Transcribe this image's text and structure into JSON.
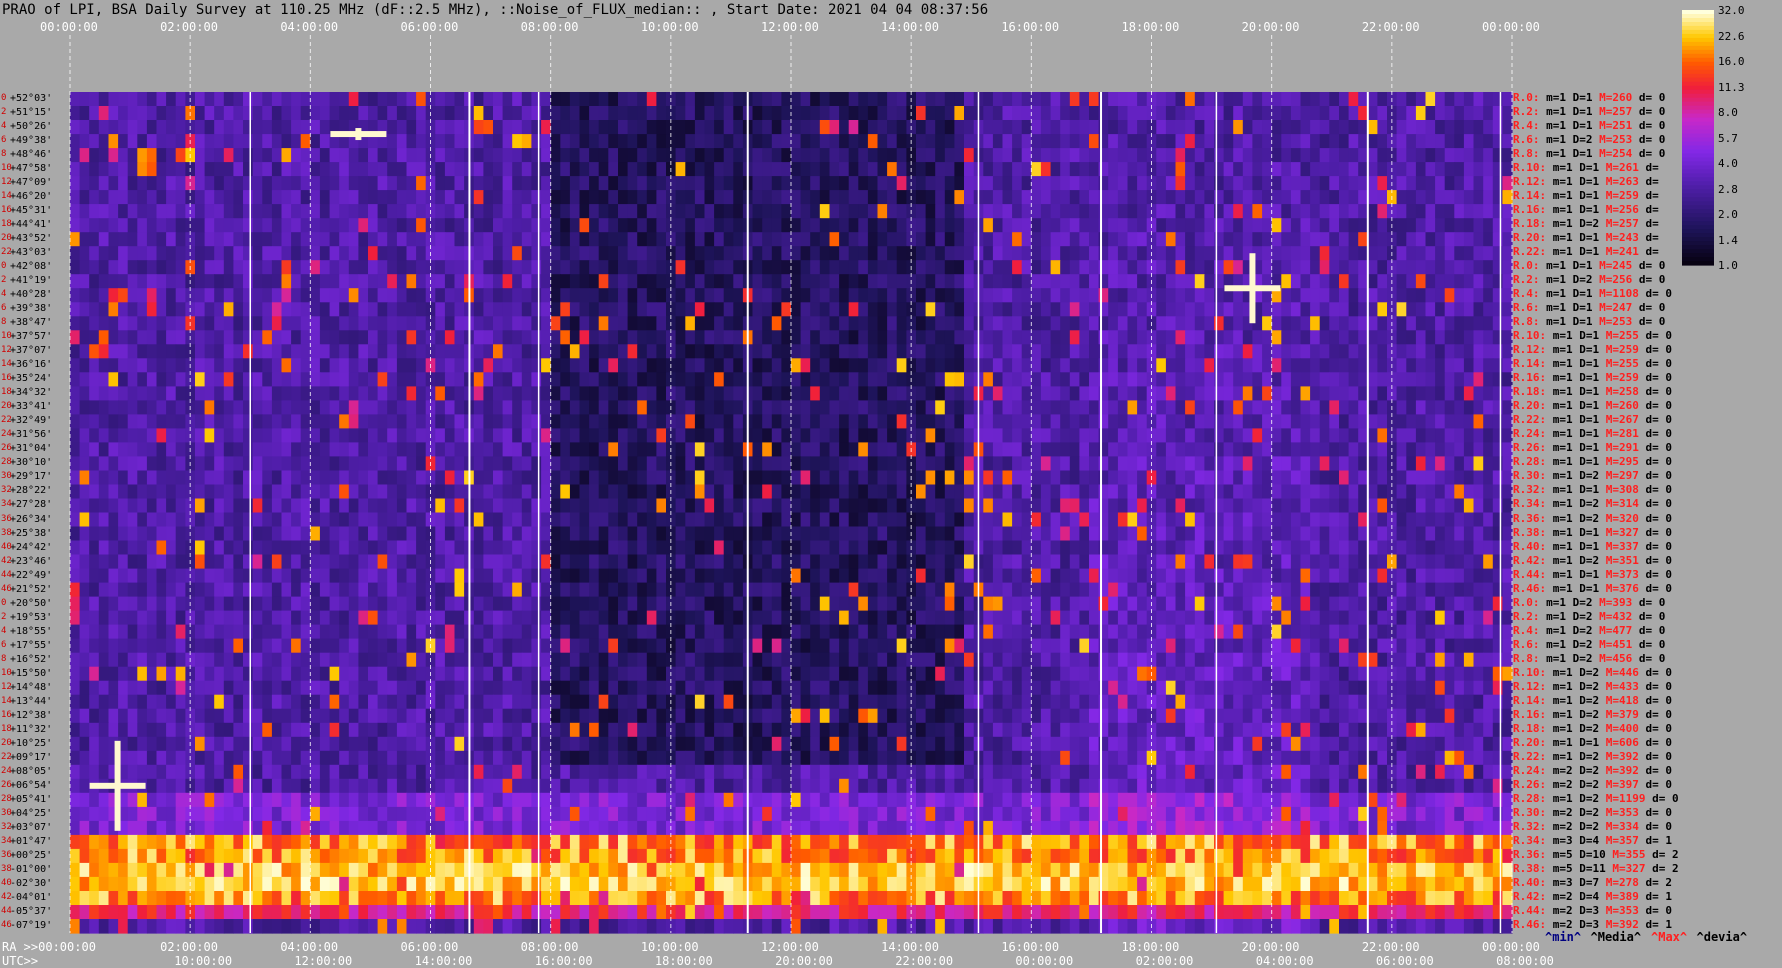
{
  "title": "PRAO of LPI, BSA Daily Survey at 110.25 MHz (dF::2.5 MHz), ::Noise_of_FLUX_median:: , Start Date: 2021 04 04 08:37:56",
  "chart_data": {
    "type": "heatmap",
    "x_axis_top": [
      "00:00:00",
      "02:00:00",
      "04:00:00",
      "06:00:00",
      "08:00:00",
      "10:00:00",
      "12:00:00",
      "14:00:00",
      "16:00:00",
      "18:00:00",
      "20:00:00",
      "22:00:00",
      "00:00:00"
    ],
    "x_axis_ra_bottom": [
      "RA >>00:00:00",
      "02:00:00",
      "04:00:00",
      "06:00:00",
      "08:00:00",
      "10:00:00",
      "12:00:00",
      "14:00:00",
      "16:00:00",
      "18:00:00",
      "20:00:00",
      "22:00:00",
      "00:00:00"
    ],
    "x_axis_utc": [
      "UTC>>",
      "10:00:00",
      "12:00:00",
      "14:00:00",
      "16:00:00",
      "18:00:00",
      "20:00:00",
      "22:00:00",
      "00:00:00",
      "02:00:00",
      "04:00:00",
      "06:00:00",
      "08:00:00"
    ],
    "y_labels": [
      "+52°03'",
      "+51°15'",
      "+50°26'",
      "+49°38'",
      "+48°46'",
      "+47°58'",
      "+47°09'",
      "+46°20'",
      "+45°31'",
      "+44°41'",
      "+43°52'",
      "+43°03'",
      "+42°08'",
      "+41°19'",
      "+40°28'",
      "+39°38'",
      "+38°47'",
      "+37°57'",
      "+37°07'",
      "+36°16'",
      "+35°24'",
      "+34°32'",
      "+33°41'",
      "+32°49'",
      "+31°56'",
      "+31°04'",
      "+30°10'",
      "+29°17'",
      "+28°22'",
      "+27°28'",
      "+26°34'",
      "+25°38'",
      "+24°42'",
      "+23°46'",
      "+22°49'",
      "+21°52'",
      "+20°50'",
      "+19°53'",
      "+18°55'",
      "+17°55'",
      "+16°52'",
      "+15°50'",
      "+14°48'",
      "+13°44'",
      "+12°38'",
      "+11°32'",
      "+10°25'",
      "+09°17'",
      "+08°05'",
      "+06°54'",
      "+05°41'",
      "+04°25'",
      "+03°07'",
      "+01°47'",
      "+00°25'",
      "-01°00'",
      "-02°30'",
      "-04°01'",
      "-05°37'",
      "-07°19'"
    ],
    "y_index": [
      "0",
      "2",
      "4",
      "6",
      "8",
      "10",
      "12",
      "14",
      "16",
      "18",
      "20",
      "22",
      "0",
      "2",
      "4",
      "6",
      "8",
      "10",
      "12",
      "14",
      "16",
      "18",
      "20",
      "22",
      "24",
      "26",
      "28",
      "30",
      "32",
      "34",
      "36",
      "38",
      "40",
      "42",
      "44",
      "46",
      "0",
      "2",
      "4",
      "6",
      "8",
      "10",
      "12",
      "14",
      "16",
      "18",
      "20",
      "22",
      "24",
      "26",
      "28",
      "30",
      "32",
      "34",
      "36",
      "38",
      "40",
      "42",
      "44",
      "46"
    ],
    "row_stats": [
      {
        "r": "R.0:",
        "m": "m=1",
        "D": "D=1",
        "M": "M=260",
        "d": "d= 0"
      },
      {
        "r": "R.2:",
        "m": "m=1",
        "D": "D=1",
        "M": "M=257",
        "d": "d= 0"
      },
      {
        "r": "R.4:",
        "m": "m=1",
        "D": "D=1",
        "M": "M=251",
        "d": "d= 0"
      },
      {
        "r": "R.6:",
        "m": "m=1",
        "D": "D=2",
        "M": "M=253",
        "d": "d= 0"
      },
      {
        "r": "R.8:",
        "m": "m=1",
        "D": "D=1",
        "M": "M=254",
        "d": "d= 0"
      },
      {
        "r": "R.10:",
        "m": "m=1",
        "D": "D=1",
        "M": "M=261",
        "d": "d="
      },
      {
        "r": "R.12:",
        "m": "m=1",
        "D": "D=1",
        "M": "M=263",
        "d": "d="
      },
      {
        "r": "R.14:",
        "m": "m=1",
        "D": "D=1",
        "M": "M=259",
        "d": "d="
      },
      {
        "r": "R.16:",
        "m": "m=1",
        "D": "D=1",
        "M": "M=256",
        "d": "d="
      },
      {
        "r": "R.18:",
        "m": "m=1",
        "D": "D=2",
        "M": "M=257",
        "d": "d="
      },
      {
        "r": "R.20:",
        "m": "m=1",
        "D": "D=1",
        "M": "M=243",
        "d": "d="
      },
      {
        "r": "R.22:",
        "m": "m=1",
        "D": "D=1",
        "M": "M=241",
        "d": "d="
      },
      {
        "r": "R.0:",
        "m": "m=1",
        "D": "D=1",
        "M": "M=245",
        "d": "d= 0"
      },
      {
        "r": "R.2:",
        "m": "m=1",
        "D": "D=2",
        "M": "M=256",
        "d": "d= 0"
      },
      {
        "r": "R.4:",
        "m": "m=1",
        "D": "D=1",
        "M": "M=1108",
        "d": "d= 0"
      },
      {
        "r": "R.6:",
        "m": "m=1",
        "D": "D=1",
        "M": "M=247",
        "d": "d= 0"
      },
      {
        "r": "R.8:",
        "m": "m=1",
        "D": "D=1",
        "M": "M=253",
        "d": "d= 0"
      },
      {
        "r": "R.10:",
        "m": "m=1",
        "D": "D=1",
        "M": "M=255",
        "d": "d= 0"
      },
      {
        "r": "R.12:",
        "m": "m=1",
        "D": "D=1",
        "M": "M=259",
        "d": "d= 0"
      },
      {
        "r": "R.14:",
        "m": "m=1",
        "D": "D=1",
        "M": "M=255",
        "d": "d= 0"
      },
      {
        "r": "R.16:",
        "m": "m=1",
        "D": "D=1",
        "M": "M=259",
        "d": "d= 0"
      },
      {
        "r": "R.18:",
        "m": "m=1",
        "D": "D=1",
        "M": "M=258",
        "d": "d= 0"
      },
      {
        "r": "R.20:",
        "m": "m=1",
        "D": "D=1",
        "M": "M=260",
        "d": "d= 0"
      },
      {
        "r": "R.22:",
        "m": "m=1",
        "D": "D=1",
        "M": "M=267",
        "d": "d= 0"
      },
      {
        "r": "R.24:",
        "m": "m=1",
        "D": "D=1",
        "M": "M=281",
        "d": "d= 0"
      },
      {
        "r": "R.26:",
        "m": "m=1",
        "D": "D=1",
        "M": "M=291",
        "d": "d= 0"
      },
      {
        "r": "R.28:",
        "m": "m=1",
        "D": "D=1",
        "M": "M=295",
        "d": "d= 0"
      },
      {
        "r": "R.30:",
        "m": "m=1",
        "D": "D=2",
        "M": "M=297",
        "d": "d= 0"
      },
      {
        "r": "R.32:",
        "m": "m=1",
        "D": "D=1",
        "M": "M=308",
        "d": "d= 0"
      },
      {
        "r": "R.34:",
        "m": "m=1",
        "D": "D=2",
        "M": "M=314",
        "d": "d= 0"
      },
      {
        "r": "R.36:",
        "m": "m=1",
        "D": "D=2",
        "M": "M=320",
        "d": "d= 0"
      },
      {
        "r": "R.38:",
        "m": "m=1",
        "D": "D=1",
        "M": "M=327",
        "d": "d= 0"
      },
      {
        "r": "R.40:",
        "m": "m=1",
        "D": "D=1",
        "M": "M=337",
        "d": "d= 0"
      },
      {
        "r": "R.42:",
        "m": "m=1",
        "D": "D=2",
        "M": "M=351",
        "d": "d= 0"
      },
      {
        "r": "R.44:",
        "m": "m=1",
        "D": "D=1",
        "M": "M=373",
        "d": "d= 0"
      },
      {
        "r": "R.46:",
        "m": "m=1",
        "D": "D=1",
        "M": "M=376",
        "d": "d= 0"
      },
      {
        "r": "R.0:",
        "m": "m=1",
        "D": "D=2",
        "M": "M=393",
        "d": "d= 0"
      },
      {
        "r": "R.2:",
        "m": "m=1",
        "D": "D=2",
        "M": "M=432",
        "d": "d= 0"
      },
      {
        "r": "R.4:",
        "m": "m=1",
        "D": "D=2",
        "M": "M=477",
        "d": "d= 0"
      },
      {
        "r": "R.6:",
        "m": "m=1",
        "D": "D=2",
        "M": "M=451",
        "d": "d= 0"
      },
      {
        "r": "R.8:",
        "m": "m=1",
        "D": "D=2",
        "M": "M=456",
        "d": "d= 0"
      },
      {
        "r": "R.10:",
        "m": "m=1",
        "D": "D=2",
        "M": "M=446",
        "d": "d= 0"
      },
      {
        "r": "R.12:",
        "m": "m=1",
        "D": "D=2",
        "M": "M=433",
        "d": "d= 0"
      },
      {
        "r": "R.14:",
        "m": "m=1",
        "D": "D=2",
        "M": "M=418",
        "d": "d= 0"
      },
      {
        "r": "R.16:",
        "m": "m=1",
        "D": "D=2",
        "M": "M=379",
        "d": "d= 0"
      },
      {
        "r": "R.18:",
        "m": "m=1",
        "D": "D=2",
        "M": "M=400",
        "d": "d= 0"
      },
      {
        "r": "R.20:",
        "m": "m=1",
        "D": "D=1",
        "M": "M=606",
        "d": "d= 0"
      },
      {
        "r": "R.22:",
        "m": "m=1",
        "D": "D=2",
        "M": "M=392",
        "d": "d= 0"
      },
      {
        "r": "R.24:",
        "m": "m=2",
        "D": "D=2",
        "M": "M=392",
        "d": "d= 0"
      },
      {
        "r": "R.26:",
        "m": "m=2",
        "D": "D=2",
        "M": "M=397",
        "d": "d= 0"
      },
      {
        "r": "R.28:",
        "m": "m=1",
        "D": "D=2",
        "M": "M=1199",
        "d": "d= 0"
      },
      {
        "r": "R.30:",
        "m": "m=2",
        "D": "D=2",
        "M": "M=353",
        "d": "d= 0"
      },
      {
        "r": "R.32:",
        "m": "m=2",
        "D": "D=2",
        "M": "M=334",
        "d": "d= 0"
      },
      {
        "r": "R.34:",
        "m": "m=3",
        "D": "D=4",
        "M": "M=357",
        "d": "d= 1"
      },
      {
        "r": "R.36:",
        "m": "m=5",
        "D": "D=10",
        "M": "M=355",
        "d": "d= 2"
      },
      {
        "r": "R.38:",
        "m": "m=5",
        "D": "D=11",
        "M": "M=327",
        "d": "d= 2"
      },
      {
        "r": "R.40:",
        "m": "m=3",
        "D": "D=7",
        "M": "M=278",
        "d": "d= 2"
      },
      {
        "r": "R.42:",
        "m": "m=2",
        "D": "D=4",
        "M": "M=389",
        "d": "d= 1"
      },
      {
        "r": "R.44:",
        "m": "m=2",
        "D": "D=3",
        "M": "M=353",
        "d": "d= 0"
      },
      {
        "r": "R.46:",
        "m": "m=2",
        "D": "D=3",
        "M": "M=392",
        "d": "d= 1"
      }
    ],
    "colorbar": [
      "32.0",
      "22.6",
      "16.0",
      "11.3",
      "8.0",
      "5.7",
      "4.0",
      "2.8",
      "2.0",
      "1.4",
      "1.0"
    ],
    "legend_bottom": [
      {
        "text": "^min^",
        "color": "#000080"
      },
      {
        "text": "^Media^",
        "color": "#000000"
      },
      {
        "text": "^Max^",
        "color": "#ff2020"
      },
      {
        "text": "^devia^",
        "color": "#000000"
      }
    ],
    "colors": {
      "background": "#a9a9a9",
      "heat_low": "#000000",
      "heat_mid": "#7a1fff",
      "heat_high": "#ff2000",
      "heat_max": "#ffffff"
    }
  }
}
